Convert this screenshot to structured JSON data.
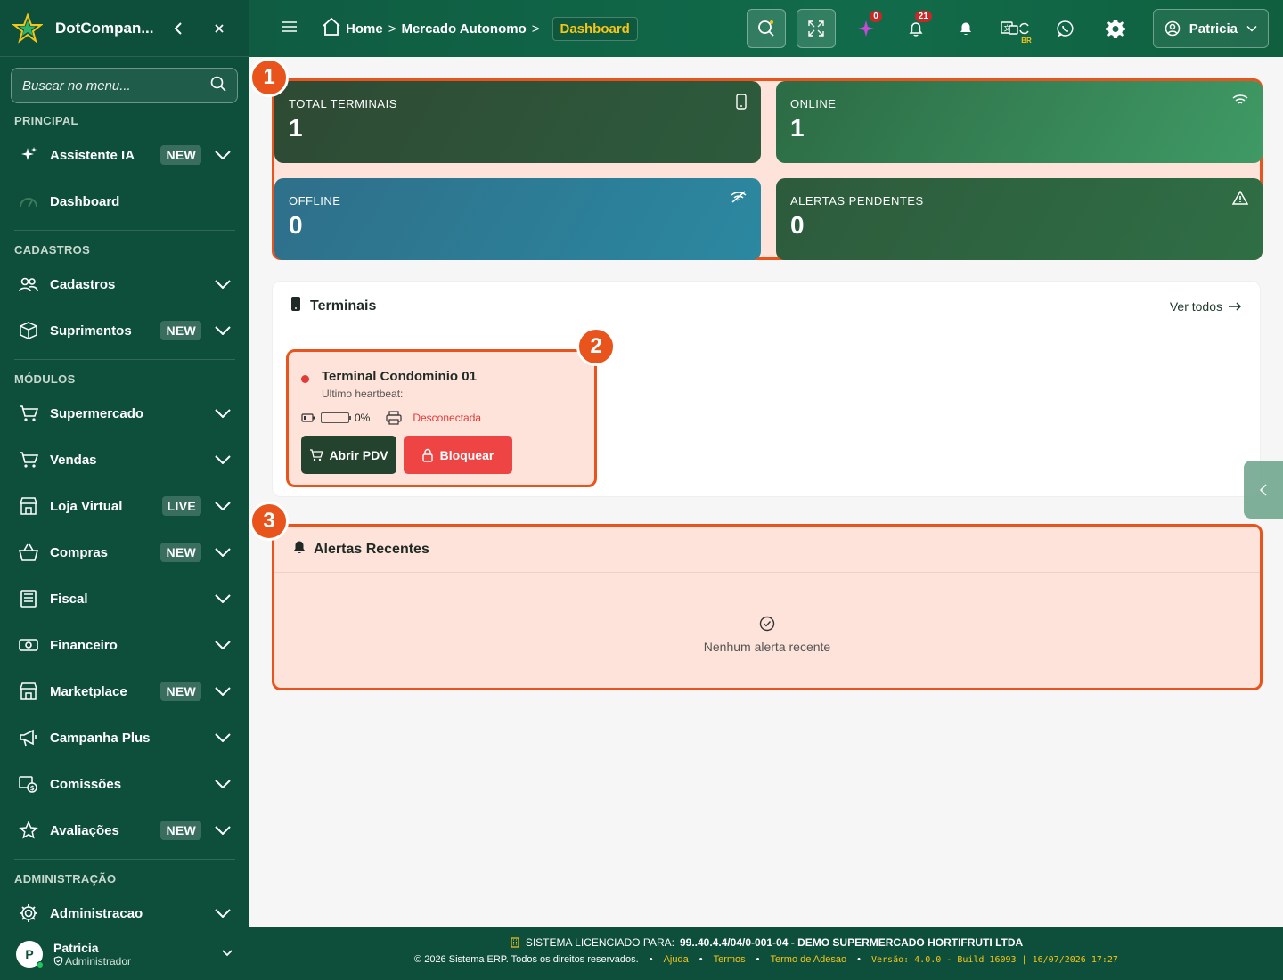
{
  "sidebar": {
    "brand": "DotCompan...",
    "search_placeholder": "Buscar no menu...",
    "sections": [
      {
        "title": "PRINCIPAL",
        "items": [
          {
            "label": "Assistente IA",
            "badge": "NEW",
            "icon": "sparkle-icon",
            "chevron": true
          },
          {
            "label": "Dashboard",
            "badge": "",
            "icon": "gauge-icon",
            "chevron": false
          }
        ]
      },
      {
        "title": "CADASTROS",
        "items": [
          {
            "label": "Cadastros",
            "badge": "",
            "icon": "users-icon",
            "chevron": true
          },
          {
            "label": "Suprimentos",
            "badge": "NEW",
            "icon": "box-icon",
            "chevron": true
          }
        ]
      },
      {
        "title": "MÓDULOS",
        "items": [
          {
            "label": "Supermercado",
            "badge": "",
            "icon": "cart-icon",
            "chevron": true
          },
          {
            "label": "Vendas",
            "badge": "",
            "icon": "cart-icon",
            "chevron": true
          },
          {
            "label": "Loja Virtual",
            "badge": "LIVE",
            "icon": "store-icon",
            "chevron": true
          },
          {
            "label": "Compras",
            "badge": "NEW",
            "icon": "basket-icon",
            "chevron": true
          },
          {
            "label": "Fiscal",
            "badge": "",
            "icon": "document-icon",
            "chevron": true
          },
          {
            "label": "Financeiro",
            "badge": "",
            "icon": "money-icon",
            "chevron": true
          },
          {
            "label": "Marketplace",
            "badge": "NEW",
            "icon": "store-icon",
            "chevron": true
          },
          {
            "label": "Campanha Plus",
            "badge": "",
            "icon": "megaphone-icon",
            "chevron": true
          },
          {
            "label": "Comissões",
            "badge": "",
            "icon": "commission-icon",
            "chevron": true
          },
          {
            "label": "Avaliações",
            "badge": "NEW",
            "icon": "star-icon",
            "chevron": true
          }
        ]
      },
      {
        "title": "ADMINISTRAÇÃO",
        "items": [
          {
            "label": "Administracao",
            "badge": "",
            "icon": "gear-icon",
            "chevron": true
          }
        ]
      }
    ],
    "user": {
      "initial": "P",
      "name": "Patricia",
      "role": "Administrador"
    }
  },
  "header": {
    "breadcrumb": [
      "Home",
      "Mercado Autonomo"
    ],
    "active": "Dashboard",
    "badges": {
      "ai": "0",
      "notifications": "21"
    },
    "lang": "BR",
    "user": "Patricia"
  },
  "stats": [
    {
      "label": "TOTAL TERMINAIS",
      "value": "1",
      "icon": "phone-icon"
    },
    {
      "label": "ONLINE",
      "value": "1",
      "icon": "wifi-icon"
    },
    {
      "label": "OFFLINE",
      "value": "0",
      "icon": "wifi-off-icon"
    },
    {
      "label": "ALERTAS PENDENTES",
      "value": "0",
      "icon": "warning-icon"
    }
  ],
  "markers": [
    "1",
    "2",
    "3"
  ],
  "terminals": {
    "title": "Terminais",
    "see_all": "Ver todos",
    "items": [
      {
        "name": "Terminal Condominio 01",
        "heartbeat": "Ultimo heartbeat:",
        "battery": "0%",
        "printer": "Desconectada",
        "open_label": "Abrir PDV",
        "lock_label": "Bloquear"
      }
    ]
  },
  "alerts": {
    "title": "Alertas Recentes",
    "empty": "Nenhum alerta recente"
  },
  "footer": {
    "license_label": "SISTEMA LICENCIADO PARA:",
    "license_value": "99..40.4.4/04/0-001-04 - DEMO SUPERMERCADO HORTIFRUTI LTDA",
    "copyright": "© 2026 Sistema ERP. Todos os direitos reservados.",
    "links": [
      "Ajuda",
      "Termos",
      "Termo de Adesao"
    ],
    "version": "Versão: 4.0.0 - Build 16093 | 16/07/2026 17:27"
  },
  "colors": {
    "sidebar": "#0e4f3b",
    "accent": "#e8541c",
    "danger": "#ef4444",
    "highlight": "#f5c518"
  }
}
